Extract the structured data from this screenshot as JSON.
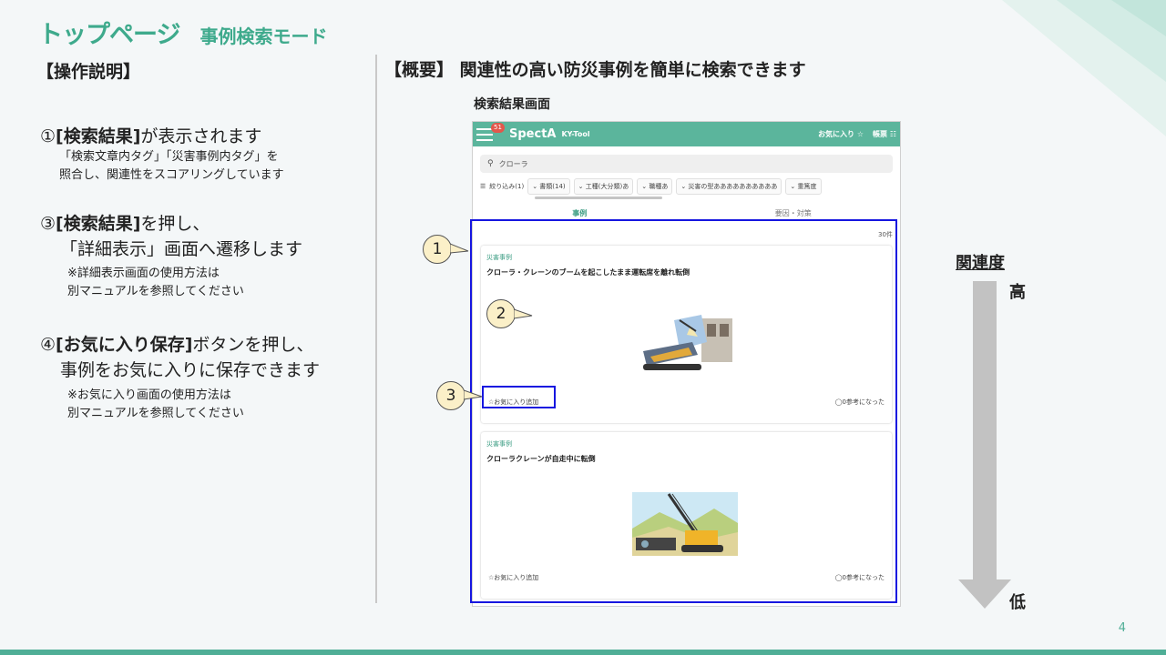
{
  "title": {
    "main": "トップページ",
    "sub": "事例検索モード"
  },
  "operations": {
    "heading": "【操作説明】",
    "step1": {
      "num": "①",
      "bold": "[検索結果]",
      "rest": "が表示されます",
      "sub1": "「検索文章内タグ」「災害事例内タグ」を",
      "sub2": "照合し、関連性をスコアリングしています"
    },
    "step3": {
      "num": "③",
      "bold": "[検索結果]",
      "rest": "を押し、",
      "line2": "「詳細表示」画面へ遷移します",
      "note1": "※詳細表示画面の使用方法は",
      "note2": "別マニュアルを参照してください"
    },
    "step4": {
      "num": "④",
      "bold": "[お気に入り保存]",
      "rest": "ボタンを押し、",
      "line2": "事例をお気に入りに保存できます",
      "note1": "※お気に入り画面の使用方法は",
      "note2": "別マニュアルを参照してください"
    }
  },
  "overview": {
    "heading": "【概要】 関連性の高い防災事例を簡単に検索できます",
    "result_label": "検索結果画面"
  },
  "app": {
    "notification_count": "51",
    "brand": "SpectA",
    "brand_sub": "KY-Tool",
    "favorites": "お気に入り ☆",
    "ledger": "帳票 ☷",
    "search_value": "クローラ",
    "filter_label": "絞り込み(1)",
    "chips": [
      "書類(14)",
      "工種(大分類)あ",
      "職種あ",
      "災害の型ああああああああああ",
      "重篤度"
    ],
    "tabs": [
      "事例",
      "要因・対策"
    ],
    "result_count": "30件",
    "cards": [
      {
        "category": "災害事例",
        "title": "クローラ・クレーンのブームを起こしたまま運転席を離れ転倒",
        "fav": "お気に入り追加",
        "ref": "0参考になった"
      },
      {
        "category": "災害事例",
        "title": "クローラクレーンが自走中に転倒",
        "fav": "お気に入り追加",
        "ref": "0参考になった"
      }
    ]
  },
  "callouts": [
    "1",
    "2",
    "3"
  ],
  "relevance": {
    "label": "関連度",
    "high": "高",
    "low": "低"
  },
  "page_number": "4",
  "colors": {
    "accent": "#3eaa8c",
    "app_header": "#5bb59c",
    "highlight": "#1616e0",
    "callout_fill": "#fbf0c8"
  }
}
